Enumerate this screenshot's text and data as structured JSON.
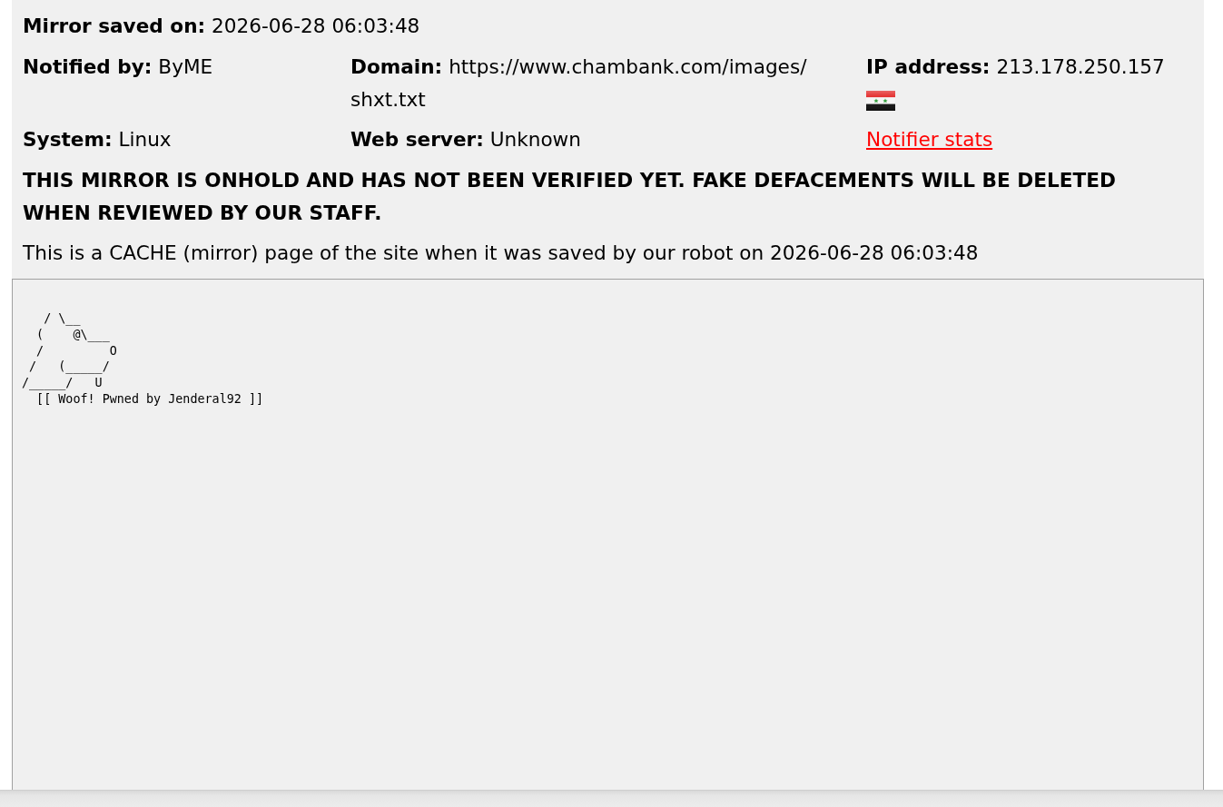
{
  "saved": {
    "label": "Mirror saved on:",
    "value": "2026-06-28 06:03:48"
  },
  "details": [
    {
      "kind": "field",
      "label": "Notified by:",
      "value": "ByME",
      "flag": false
    },
    {
      "kind": "field",
      "label": "Domain:",
      "value": "https://www.chambank.com/images/shxt.txt",
      "flag": false
    },
    {
      "kind": "field",
      "label": "IP address:",
      "value": "213.178.250.157",
      "flag": true
    },
    {
      "kind": "field",
      "label": "System:",
      "value": "Linux",
      "flag": false
    },
    {
      "kind": "field",
      "label": "Web server:",
      "value": "Unknown",
      "flag": false
    },
    {
      "kind": "link",
      "text": "Notifier stats",
      "flag": false
    }
  ],
  "notice": "THIS MIRROR IS ONHOLD AND HAS NOT BEEN VERIFIED YET. FAKE DEFACEMENTS WILL BE DELETED WHEN REVIEWED BY OUR STAFF.",
  "cache_note": "This is a CACHE (mirror) page of the site when it was saved by our robot on 2026-06-28 06:03:48",
  "mirror": {
    "lines": [
      "   / \\__",
      "  (    @\\___",
      "  /         O",
      " /   (_____/",
      "/_____/   U",
      "  [[ Woof! Pwned by Jenderal92 ]]"
    ]
  }
}
